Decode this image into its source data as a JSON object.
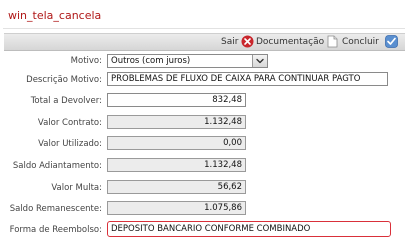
{
  "window": {
    "title": "win_tela_cancela"
  },
  "toolbar": {
    "sair_label": "Sair",
    "documentacao_label": "Documentação",
    "concluir_label": "Concluir"
  },
  "form": {
    "motivo": {
      "label": "Motivo:",
      "value": "Outros (com juros)"
    },
    "descricao_motivo": {
      "label": "Descrição Motivo:",
      "value": "PROBLEMAS DE FLUXO DE CAIXA PARA CONTINUAR PAGTO"
    },
    "total_a_devolver": {
      "label": "Total a Devolver:",
      "value": "832,48"
    },
    "valor_contrato": {
      "label": "Valor Contrato:",
      "value": "1.132,48"
    },
    "valor_utilizado": {
      "label": "Valor Utilizado:",
      "value": "0,00"
    },
    "saldo_adiantamento": {
      "label": "Saldo Adiantamento:",
      "value": "1.132,48"
    },
    "valor_multa": {
      "label": "Valor Multa:",
      "value": "56,62"
    },
    "saldo_remanescente": {
      "label": "Saldo Remanescente:",
      "value": "1.075,86"
    },
    "forma_de_reembolso": {
      "label": "Forma de Reembolso:",
      "value": "DEPOSITO BANCARIO CONFORME COMBINADO"
    }
  },
  "colors": {
    "title": "#b01818",
    "focus_border": "#d9303a",
    "readonly_bg": "#ececec"
  },
  "icons": {
    "sair": "close-icon",
    "documentacao": "document-icon",
    "concluir": "checkmark-icon",
    "dropdown": "chevron-down-icon"
  }
}
